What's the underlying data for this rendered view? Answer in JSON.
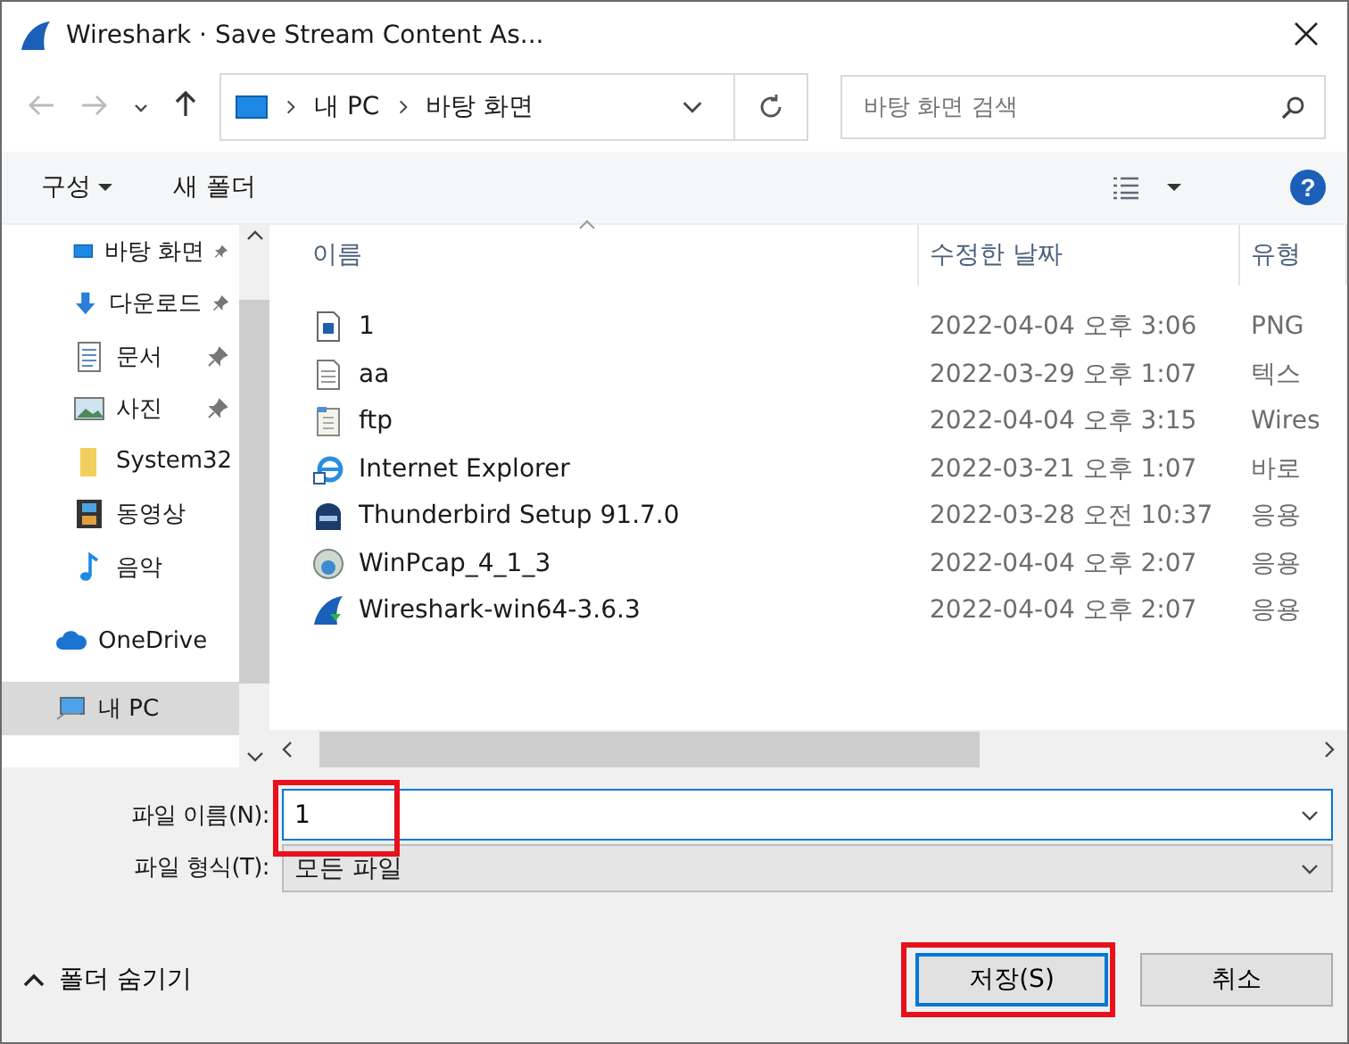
{
  "window": {
    "title": "Wireshark · Save Stream Content As..."
  },
  "nav": {
    "back_disabled": true,
    "forward_disabled": true,
    "breadcrumb": [
      "내 PC",
      "바탕 화면"
    ],
    "search": {
      "placeholder": "바탕 화면 검색"
    }
  },
  "toolbar": {
    "organize": "구성",
    "new_folder": "새 폴더",
    "help": "?"
  },
  "sidebar": {
    "items": [
      {
        "label": "바탕 화면",
        "kind": "desktop",
        "pinned": true,
        "selected": false
      },
      {
        "label": "다운로드",
        "kind": "download",
        "pinned": true,
        "selected": false
      },
      {
        "label": "문서",
        "kind": "document",
        "pinned": true,
        "selected": false
      },
      {
        "label": "사진",
        "kind": "picture",
        "pinned": true,
        "selected": false
      },
      {
        "label": "System32",
        "kind": "folder",
        "pinned": false,
        "selected": false
      },
      {
        "label": "동영상",
        "kind": "video",
        "pinned": false,
        "selected": false
      },
      {
        "label": "음악",
        "kind": "music",
        "pinned": false,
        "selected": false
      },
      {
        "label": "OneDrive",
        "kind": "cloud",
        "pinned": false,
        "selected": false
      },
      {
        "label": "내 PC",
        "kind": "pc",
        "pinned": false,
        "selected": true
      }
    ]
  },
  "file_list": {
    "columns": [
      "이름",
      "수정한 날짜",
      "유형"
    ],
    "rows": [
      {
        "name": "1",
        "modified": "2022-04-04 오후 3:06",
        "type": "PNG",
        "kind": "image"
      },
      {
        "name": "aa",
        "modified": "2022-03-29 오후 1:07",
        "type": "텍스",
        "kind": "text"
      },
      {
        "name": "ftp",
        "modified": "2022-04-04 오후 3:15",
        "type": "Wires",
        "kind": "capture"
      },
      {
        "name": "Internet Explorer",
        "modified": "2022-03-21 오후 1:07",
        "type": "바로",
        "kind": "browser"
      },
      {
        "name": "Thunderbird Setup 91.7.0",
        "modified": "2022-03-28 오전 10:37",
        "type": "응용",
        "kind": "installer"
      },
      {
        "name": "WinPcap_4_1_3",
        "modified": "2022-04-04 오후 2:07",
        "type": "응용",
        "kind": "globe"
      },
      {
        "name": "Wireshark-win64-3.6.3",
        "modified": "2022-04-04 오후 2:07",
        "type": "응용",
        "kind": "fin"
      }
    ]
  },
  "form": {
    "file_name": {
      "label": "파일 이름(N):",
      "value": "1",
      "highlighted": true
    },
    "file_type": {
      "label": "파일 형식(T):",
      "value": "모든 파일"
    }
  },
  "hide_folders": "폴더 숨기기",
  "buttons": [
    {
      "label": "저장(S)",
      "default": true,
      "highlighted": true
    },
    {
      "label": "취소",
      "default": false,
      "highlighted": false
    }
  ]
}
